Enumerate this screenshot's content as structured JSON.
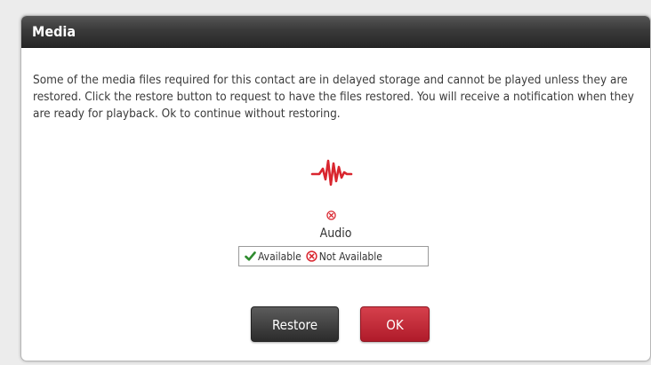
{
  "dialog": {
    "title": "Media",
    "message": "Some of the media files required for this contact are in delayed storage and cannot be played unless they are restored. Click the restore button to request to have the files restored. You will receive a notification when they are ready for playback. Ok to continue without restoring.",
    "media_item": {
      "label": "Audio",
      "icon": "audio-waveform-icon",
      "status": "not-available"
    },
    "legend": {
      "available_label": "Available",
      "not_available_label": "Not Available"
    },
    "buttons": {
      "restore_label": "Restore",
      "ok_label": "OK"
    }
  },
  "colors": {
    "header_bg": "#333333",
    "accent_red": "#d9262f",
    "available_green": "#2e8b2e",
    "restore_button": "#3b3b3b",
    "ok_button": "#c42a36"
  }
}
